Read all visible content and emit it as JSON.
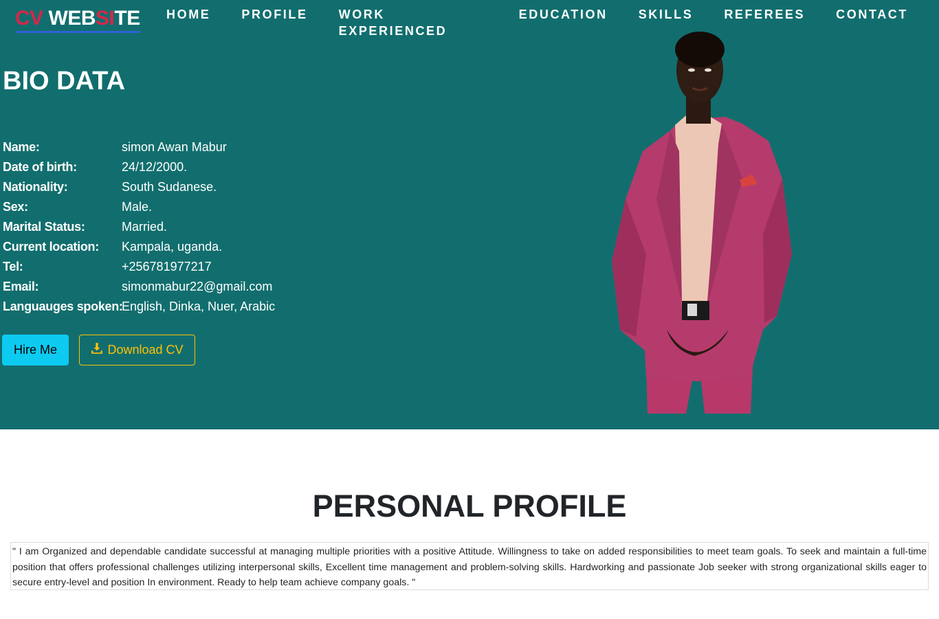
{
  "logo": {
    "part1": "CV ",
    "part2": "WEB",
    "part3": "SI",
    "part4": "TE"
  },
  "nav": [
    "HOME",
    "PROFILE",
    "WORK EXPERIENCED",
    "EDUCATION",
    "SKILLS",
    "REFEREES",
    "CONTACT"
  ],
  "bio": {
    "title": "BIO DATA",
    "rows": [
      {
        "label": "Name:",
        "value": "simon Awan Mabur"
      },
      {
        "label": "Date of birth:",
        "value": "24/12/2000."
      },
      {
        "label": "Nationality:",
        "value": "South Sudanese."
      },
      {
        "label": "Sex:",
        "value": "Male."
      },
      {
        "label": "Marital Status:",
        "value": "Married."
      },
      {
        "label": "Current location:",
        "value": "Kampala, uganda."
      },
      {
        "label": "Tel:",
        "value": "+256781977217"
      },
      {
        "label": "Email:",
        "value": "simonmabur22@gmail.com"
      },
      {
        "label": "Languauges spoken:",
        "value": "English, Dinka, Nuer, Arabic"
      }
    ]
  },
  "buttons": {
    "hire": "Hire Me",
    "download": "Download CV"
  },
  "icons": {
    "download": "download-icon"
  },
  "colors": {
    "hero_bg": "#126e6e",
    "accent_red": "#d6264b",
    "hire_bg": "#0dcaf0",
    "download_outline": "#ffc107"
  },
  "profile": {
    "title": "PERSONAL PROFILE",
    "text": "\" I am Organized and dependable candidate successful at managing multiple priorities with a positive Attitude. Willingness to take on added responsibilities to meet team goals. To seek and maintain a full-time position that offers professional challenges utilizing interpersonal skills, Excellent time management and problem-solving skills. Hardworking and passionate Job seeker with strong organizational skills eager to secure entry-level and position In environment. Ready to help team achieve company goals. \""
  }
}
